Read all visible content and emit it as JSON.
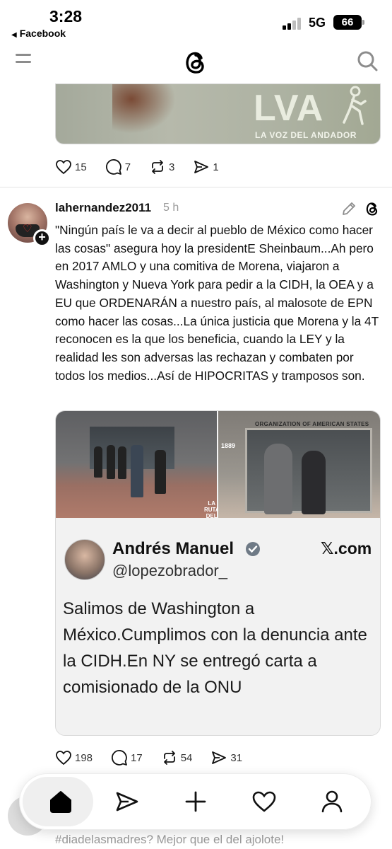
{
  "status_bar": {
    "time": "3:28",
    "back_app": "Facebook",
    "network": "5G",
    "battery": "66"
  },
  "top_nav": {
    "menu_icon": "menu-icon",
    "logo_icon": "threads-logo-icon",
    "search_icon": "search-icon"
  },
  "previous_post": {
    "image_brand": "LVA",
    "image_brand_subtitle": "LA VOZ DEL ANDADOR",
    "likes": "15",
    "replies": "7",
    "reposts": "3",
    "shares": "1"
  },
  "post": {
    "username": "lahernandez2011",
    "time": "5 h",
    "text": "\"Ningún país le va a decir al pueblo de México como hacer las cosas\" asegura hoy la presidentE Sheinbaum...Ah pero en 2017 AMLO y una comitiva de Morena, viajaron a Washington y Nueva York para pedir a la CIDH, la OEA y a EU que ORDENARÁN a nuestro país, al malosote de EPN como hacer las cosas...La única justicia que Morena y la 4T reconocen es la que los beneficia, cuando la LEY y la realidad les son adversas las rechazan y combaten por todos los medios...Así de HIPOCRITAS y tramposos son.",
    "media": {
      "oas_sign": "ORGANIZATION OF AMERICAN STATES",
      "year": "1889",
      "watermark": "LA RUTA DEL REY",
      "tweet": {
        "name": "Andrés Manuel",
        "handle": "@lopezobrador_",
        "source": "𝕏.com",
        "text": "Salimos de Washington a México.Cumplimos con la denuncia ante la CIDH.En NY se entregó carta a comisionado de la ONU"
      }
    },
    "likes": "198",
    "replies": "17",
    "reposts": "54",
    "shares": "31"
  },
  "next_post": {
    "preview_text": "#diadelasmadres? Mejor que el del ajolote!"
  },
  "bottom_nav": {
    "items": [
      "home-icon",
      "send-icon",
      "plus-icon",
      "heart-icon",
      "profile-icon"
    ]
  }
}
